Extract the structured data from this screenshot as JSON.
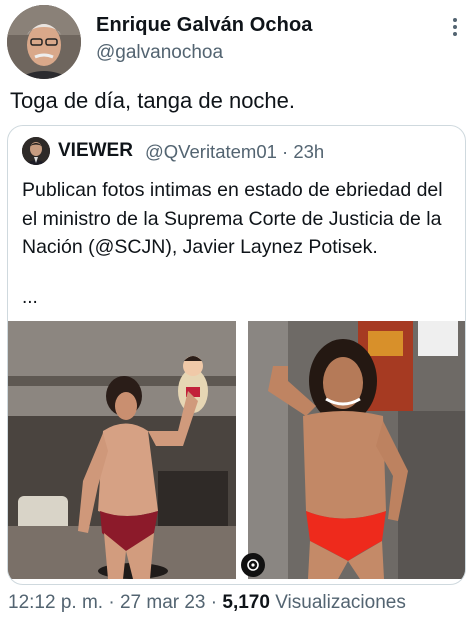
{
  "author": {
    "name": "Enrique Galván Ochoa",
    "handle": "@galvanochoa",
    "avatar_icon": "profile-photo"
  },
  "tweet": {
    "text": "Toga de día, tanga de noche."
  },
  "quoted": {
    "name": "VIEWER",
    "handle": "@QVeritatem01",
    "separator": "·",
    "time": "23h",
    "text": "Publican fotos intimas en estado de ebriedad del el ministro de la Suprema Corte de Justicia de la Nación (@SCJN), Javier Laynez Potisek.",
    "ellipsis": "..."
  },
  "meta": {
    "time": "12:12 p. m.",
    "separator": "·",
    "date": "27 mar 23",
    "views_count": "5,170",
    "views_label": "Visualizaciones"
  },
  "colors": {
    "text_primary": "#0f1419",
    "text_secondary": "#536471",
    "border": "#cfd9de"
  }
}
